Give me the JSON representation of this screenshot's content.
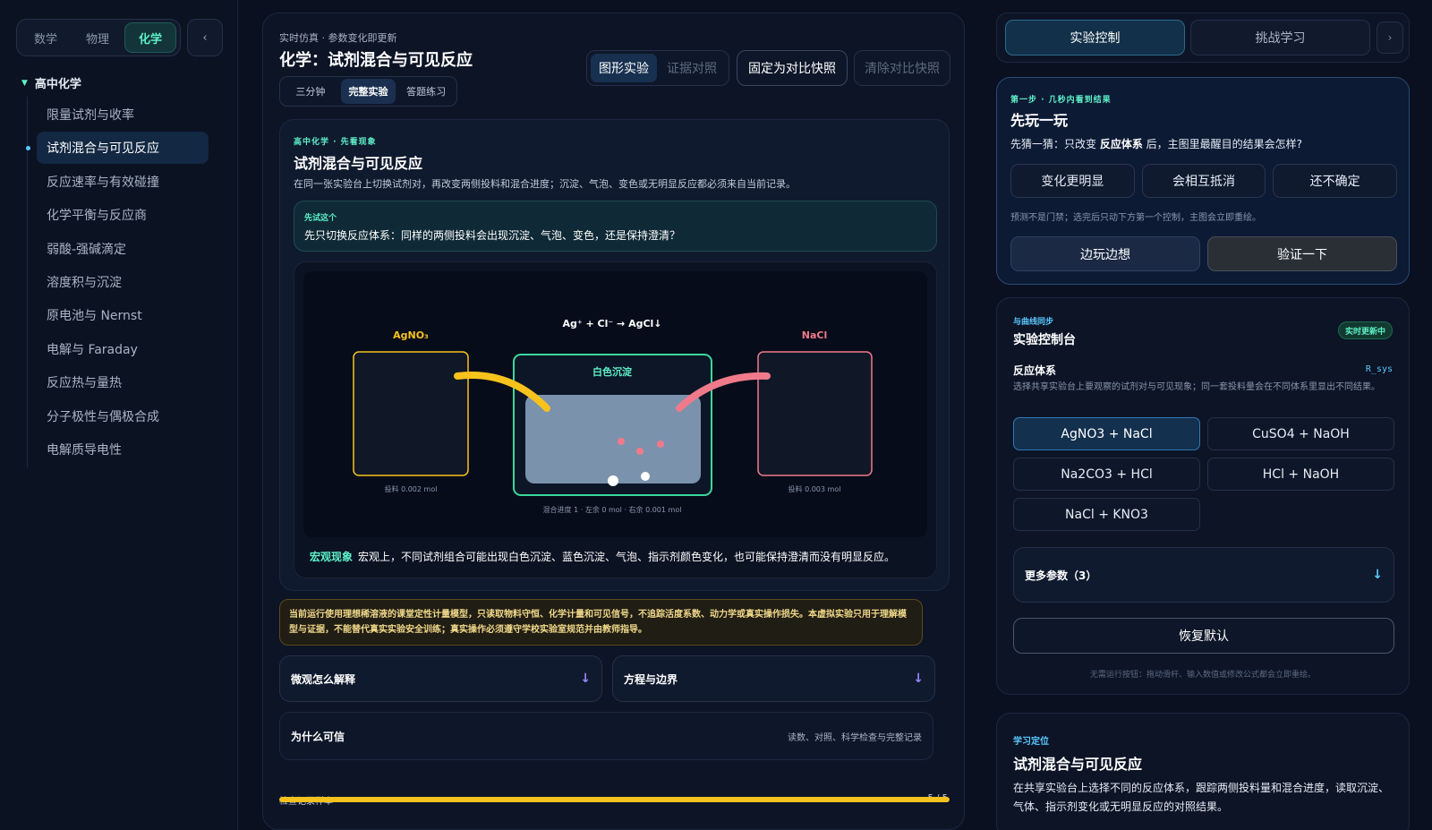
{
  "sidebar": {
    "subjects": [
      "数学",
      "物理",
      "化学"
    ],
    "active_subject": "化学",
    "collapse_glyph": "‹",
    "group_title": "高中化学",
    "items": [
      "限量试剂与收率",
      "试剂混合与可见反应",
      "反应速率与有效碰撞",
      "化学平衡与反应商",
      "弱酸-强碱滴定",
      "溶度积与沉淀",
      "原电池与 Nernst",
      "电解与 Faraday",
      "反应热与量热",
      "分子极性与偶极合成",
      "电解质导电性"
    ],
    "active_item": "试剂混合与可见反应"
  },
  "main": {
    "kicker": "实时仿真 · 参数变化即更新",
    "title": "化学：试剂混合与可见反应",
    "modes": [
      "三分钟",
      "完整实验",
      "答题练习"
    ],
    "active_mode": "完整实验",
    "view_toggle": [
      "图形实验",
      "证据对照"
    ],
    "pin_label": "固定为对比快照",
    "clear_label": "清除对比快照",
    "card": {
      "kicker": "高中化学 · 先看现象",
      "title": "试剂混合与可见反应",
      "desc": "在同一张实验台上切换试剂对，再改变两侧投料和混合进度；沉淀、气泡、变色或无明显反应都必须来自当前记录。",
      "hint_kicker": "先试这个",
      "hint_text": "先只切换反应体系：同样的两侧投料会出现沉淀、气泡、变色，还是保持澄清？",
      "macro_tag": "宏观现象",
      "macro_text": "宏观上，不同试剂组合可能出现白色沉淀、蓝色沉淀、气泡、指示剂颜色变化，也可能保持澄清而没有明显反应。"
    },
    "warning": "当前运行使用理想稀溶液的课堂定性计量模型，只读取物料守恒、化学计量和可见信号，不追踪活度系数、动力学或真实操作损失。本虚拟实验只用于理解模型与证据，不能替代真实实验安全训练；真实操作必须遵守学校实验室规范并由教师指导。",
    "accordions": [
      "微观怎么解释",
      "方程与边界"
    ],
    "acc_glyph": "↓",
    "trust_left": "为什么可信",
    "trust_right": "读数、对照、科学检查与完整记录",
    "sample_label": "检查记录样本",
    "sample_count": "5 / 5",
    "sample_fraction": 1.0
  },
  "chart_data": {
    "type": "diagram",
    "equation": "Ag⁺ + Cl⁻ → AgCl↓",
    "left_beaker_label": "AgNO₃",
    "right_beaker_label": "NaCl",
    "left_feed": "投料 0.002 mol",
    "right_feed": "投料 0.003 mol",
    "center_label": "白色沉淀",
    "mix_caption": "混合进度 1 · 左余 0 mol · 右余 0.001 mol",
    "colors": {
      "left": "#f8c21c",
      "right": "#f07a8a",
      "center": "#3ad89a",
      "liquid": "#7b92ad",
      "precip": "#f07a8a"
    }
  },
  "right": {
    "nav": [
      "实验控制",
      "挑战学习"
    ],
    "nav_next": "›",
    "play": {
      "kicker": "第一步 · 几秒内看到结果",
      "title": "先玩一玩",
      "question_pre": "先猜一猜：只改变 ",
      "question_bold": "反应体系",
      "question_post": " 后，主图里最醒目的结果会怎样?",
      "guesses": [
        "变化更明显",
        "会相互抵消",
        "还不确定"
      ],
      "note": "预测不是门禁；选完后只动下方第一个控制，主图会立即重绘。",
      "actions": [
        "边玩边想",
        "验证一下"
      ]
    },
    "control": {
      "kicker": "与曲线同步",
      "title": "实验控制台",
      "badge": "实时更新中",
      "label": "反应体系",
      "symbol": "R_sys",
      "desc": "选择共享实验台上要观察的试剂对与可见现象；同一套投料量会在不同体系里显出不同结果。",
      "options": [
        "AgNO3 + NaCl",
        "CuSO4 + NaOH",
        "Na2CO3 + HCl",
        "HCl + NaOH",
        "NaCl + KNO3"
      ],
      "active_option": "AgNO3 + NaCl",
      "more": "更多参数（3）",
      "more_glyph": "↓",
      "reset": "恢复默认",
      "foot": "无需运行按钮：拖动滑杆、输入数值或修改公式都会立即重绘。"
    },
    "learn": {
      "kicker": "学习定位",
      "title": "试剂混合与可见反应",
      "desc": "在共享实验台上选择不同的反应体系，跟踪两侧投料量和混合进度，读取沉淀、气体、指示剂变化或无明显反应的对照结果。"
    }
  }
}
